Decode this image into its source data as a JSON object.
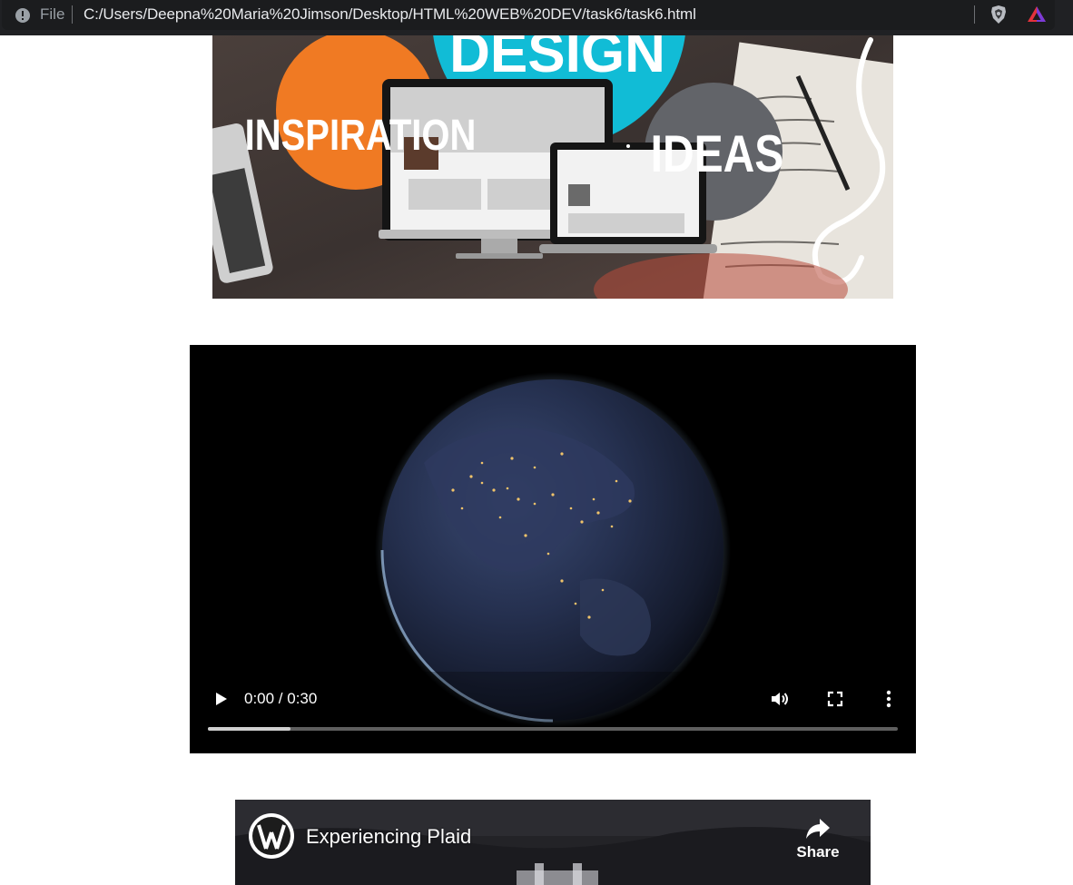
{
  "browser": {
    "scheme_label": "File",
    "url": "C:/Users/Deepna%20Maria%20Jimson/Desktop/HTML%20WEB%20DEV/task6/task6.html"
  },
  "banner": {
    "words": [
      "DESIGN",
      "INSPIRATION",
      "IDEAS"
    ]
  },
  "video": {
    "time": "0:00 / 0:30",
    "buffered_fraction": 0.12
  },
  "embed": {
    "title": "Experiencing Plaid",
    "share_label": "Share"
  }
}
